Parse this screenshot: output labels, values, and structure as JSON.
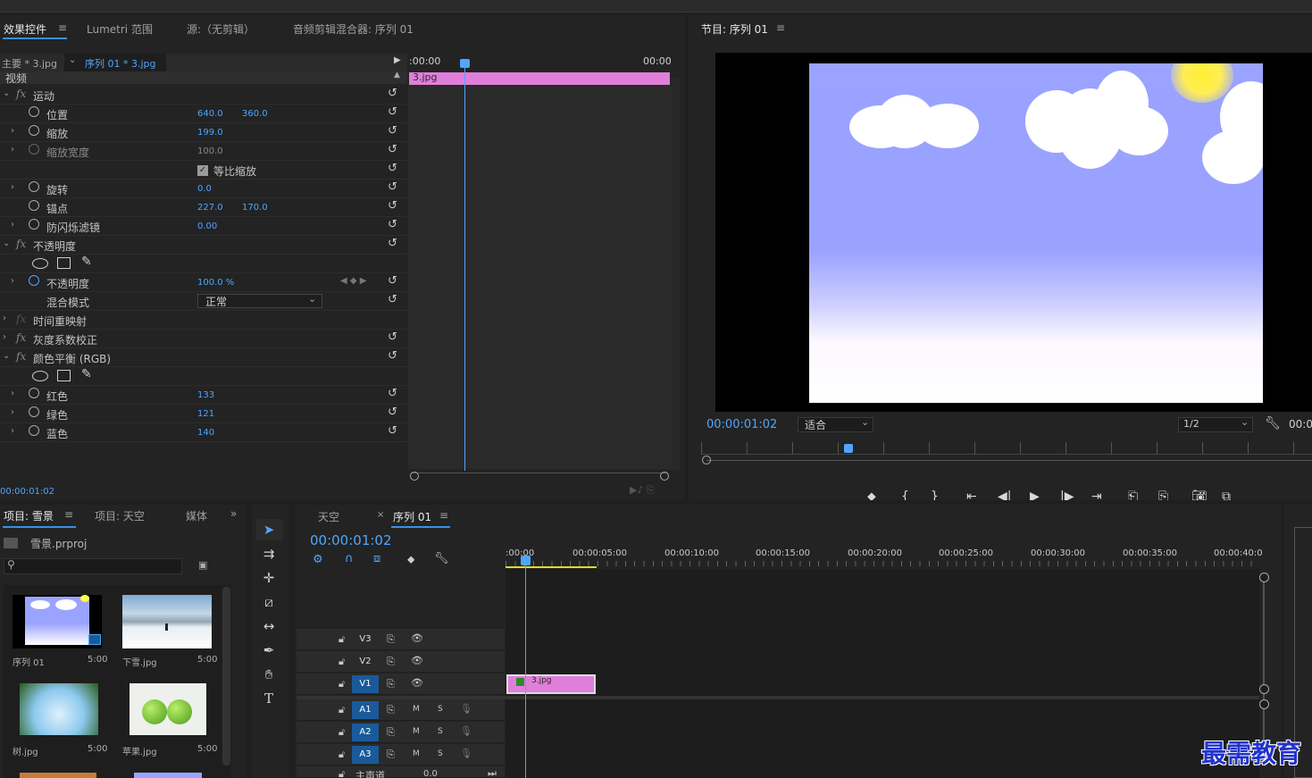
{
  "effect_controls": {
    "tabs": [
      "效果控件",
      "Lumetri 范围",
      "源:（无剪辑）",
      "音频剪辑混合器: 序列 01"
    ],
    "master_clip": "主要 * 3.jpg",
    "sequence_clip": "序列 01 * 3.jpg",
    "section_video": "视频",
    "timeline_start": ":00:00",
    "timeline_end": "00:00",
    "clip_name": "3.jpg",
    "timecode": "00:00:01:02",
    "rows": {
      "motion": "运动",
      "position": {
        "label": "位置",
        "x": "640.0",
        "y": "360.0"
      },
      "scale": {
        "label": "缩放",
        "value": "199.0"
      },
      "scale_width": {
        "label": "缩放宽度",
        "value": "100.0"
      },
      "uniform_scale": "等比缩放",
      "rotation": {
        "label": "旋转",
        "value": "0.0"
      },
      "anchor": {
        "label": "锚点",
        "x": "227.0",
        "y": "170.0"
      },
      "antiflicker": {
        "label": "防闪烁滤镜",
        "value": "0.00"
      },
      "opacity_group": "不透明度",
      "opacity": {
        "label": "不透明度",
        "value": "100.0 %"
      },
      "blend_mode": {
        "label": "混合模式",
        "value": "正常"
      },
      "time_remap": "时间重映射",
      "gamma": "灰度系数校正",
      "color_balance": "颜色平衡 (RGB)",
      "red": {
        "label": "红色",
        "value": "133"
      },
      "green": {
        "label": "绿色",
        "value": "121"
      },
      "blue": {
        "label": "蓝色",
        "value": "140"
      }
    }
  },
  "program_monitor": {
    "title": "节目: 序列 01",
    "timecode": "00:00:01:02",
    "fit": "适合",
    "resolution": "1/2",
    "right_time": "00:0"
  },
  "project": {
    "tabs": [
      "项目: 雪景",
      "项目: 天空",
      "媒体"
    ],
    "file": "雪景.prproj",
    "items": [
      {
        "name": "序列 01",
        "dur": "5:00"
      },
      {
        "name": "下雪.jpg",
        "dur": "5:00"
      },
      {
        "name": "树.jpg",
        "dur": "5:00"
      },
      {
        "name": "苹果.jpg",
        "dur": "5:00"
      }
    ]
  },
  "timeline": {
    "tabs": [
      "天空",
      "序列 01"
    ],
    "timecode": "00:00:01:02",
    "ruler": [
      ":00:00",
      "00:00:05:00",
      "00:00:10:00",
      "00:00:15:00",
      "00:00:20:00",
      "00:00:25:00",
      "00:00:30:00",
      "00:00:35:00",
      "00:00:40:0"
    ],
    "video_tracks": [
      "V3",
      "V2",
      "V1"
    ],
    "audio_tracks": [
      "A1",
      "A2",
      "A3"
    ],
    "mute": "M",
    "solo": "S",
    "master": "主声道",
    "master_value": "0.0",
    "clip": "3.jpg"
  },
  "watermark": "最需教育",
  "colors": {
    "accent": "#3a8ee6",
    "clip": "#e07fd9",
    "sky": "#9aa3ff",
    "playhead": "#4ea6ff"
  }
}
